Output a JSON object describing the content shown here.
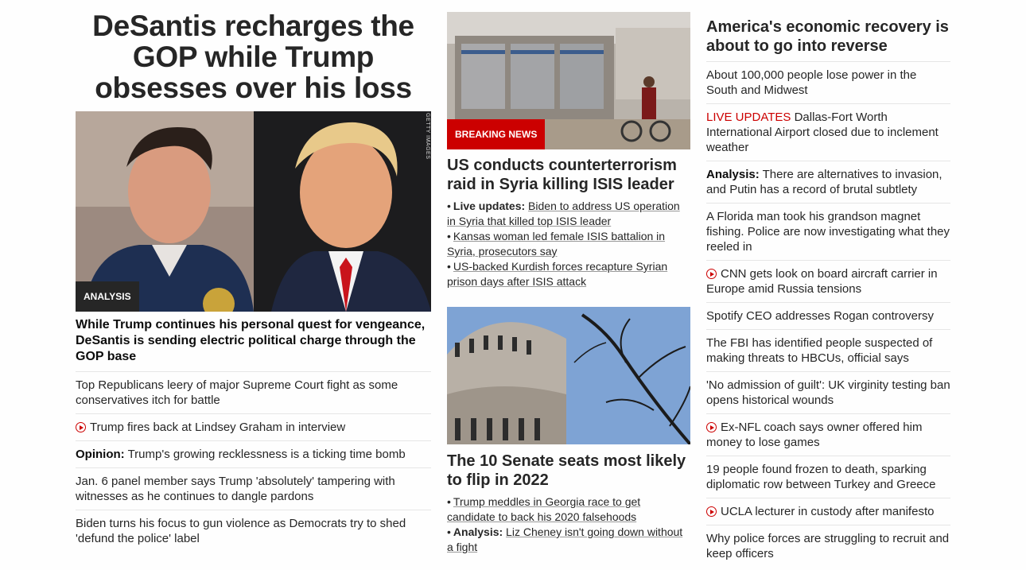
{
  "col1": {
    "headline": "DeSantis recharges the GOP while Trump obsesses over his loss",
    "image_badge": "ANALYSIS",
    "image_credit": "GETTY IMAGES",
    "lead": "While Trump continues his personal quest for vengeance, DeSantis is sending electric political charge through the GOP base",
    "items": [
      {
        "text": "Top Republicans leery of major Supreme Court fight as some conservatives itch for battle"
      },
      {
        "video": true,
        "text": "Trump fires back at Lindsey Graham in interview"
      },
      {
        "label": "Opinion:",
        "text": "Trump's growing recklessness is a ticking time bomb"
      },
      {
        "text": "Jan. 6 panel member says Trump 'absolutely' tampering with witnesses as he continues to dangle pardons"
      },
      {
        "text": "Biden turns his focus to gun violence as Democrats try to shed 'defund the police' label"
      }
    ]
  },
  "col2": {
    "story1": {
      "badge": "BREAKING NEWS",
      "headline": "US conducts counterterrorism raid in Syria killing ISIS leader",
      "bullets": [
        {
          "label": "Live updates:",
          "text": "Biden to address US operation in Syria that killed top ISIS leader"
        },
        {
          "text": "Kansas woman led female ISIS battalion in Syria, prosecutors say"
        },
        {
          "text": "US-backed Kurdish forces recapture Syrian prison days after ISIS attack"
        }
      ]
    },
    "story2": {
      "headline": "The 10 Senate seats most likely to flip in 2022",
      "bullets": [
        {
          "text": "Trump meddles in Georgia race to get candidate to back his 2020 falsehoods"
        },
        {
          "label": "Analysis:",
          "text": "Liz Cheney isn't going down without a fight"
        }
      ]
    }
  },
  "col3": {
    "headline": "America's economic recovery is about to go into reverse",
    "items": [
      {
        "text": "About 100,000 people lose power in the South and Midwest"
      },
      {
        "live": "LIVE UPDATES",
        "text": "Dallas-Fort Worth International Airport closed due to inclement weather"
      },
      {
        "label": "Analysis:",
        "text": "There are alternatives to invasion, and Putin has a record of brutal subtlety"
      },
      {
        "text": "A Florida man took his grandson magnet fishing. Police are now investigating what they reeled in"
      },
      {
        "video": true,
        "text": "CNN gets look on board aircraft carrier in Europe amid Russia tensions"
      },
      {
        "text": "Spotify CEO addresses Rogan controversy"
      },
      {
        "text": "The FBI has identified people suspected of making threats to HBCUs, official says"
      },
      {
        "text": "'No admission of guilt': UK virginity testing ban opens historical wounds"
      },
      {
        "video": true,
        "text": "Ex-NFL coach says owner offered him money to lose games"
      },
      {
        "text": "19 people found frozen to death, sparking diplomatic row between Turkey and Greece"
      },
      {
        "video": true,
        "text": "UCLA lecturer in custody after manifesto"
      },
      {
        "text": "Why police forces are struggling to recruit and keep officers"
      }
    ]
  },
  "colors": {
    "accent_red": "#cc0000",
    "text": "#262626",
    "divider": "#e6e6e6"
  }
}
